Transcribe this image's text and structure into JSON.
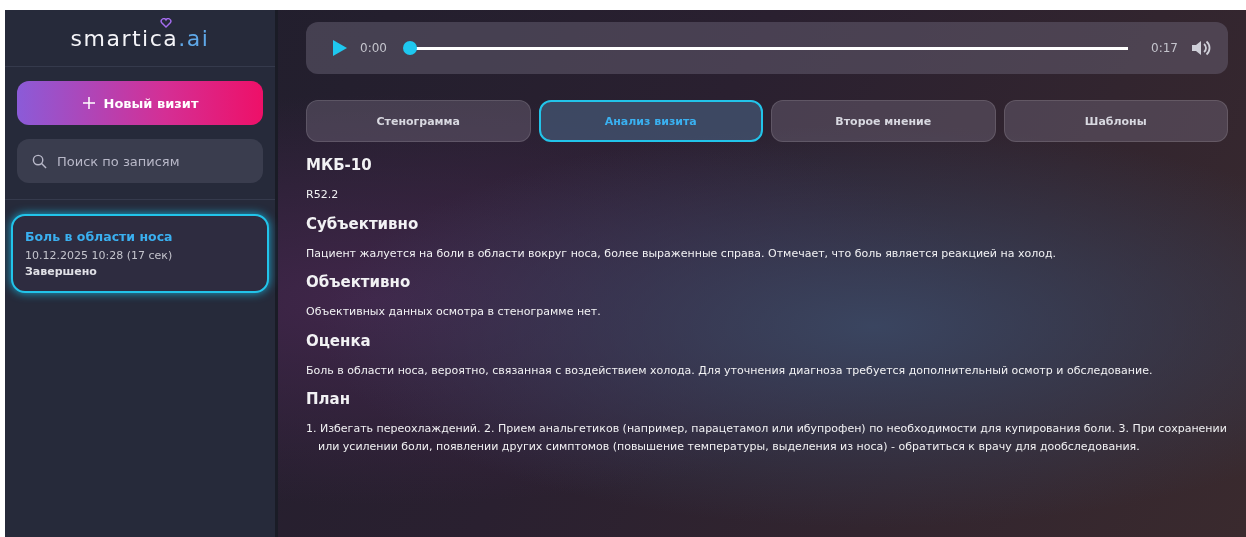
{
  "sidebar": {
    "logo": {
      "name": "smartica",
      "suffix": ".ai"
    },
    "new_button": {
      "label": "Новый визит"
    },
    "search": {
      "placeholder": "Поиск по записям"
    },
    "visits": [
      {
        "title": "Боль в области носа",
        "date": "10.12.2025 10:28 (17 сек)",
        "status": "Завершено",
        "selected": true
      }
    ]
  },
  "player": {
    "current": "0:00",
    "duration": "0:17",
    "level": 0
  },
  "tabs": [
    {
      "label": "Стенограмма",
      "selected": false
    },
    {
      "label": "Анализ визита",
      "selected": true
    },
    {
      "label": "Второе мнение",
      "selected": false
    },
    {
      "label": "Шаблоны",
      "selected": false
    }
  ],
  "sections": [
    {
      "heading": "МКБ-10",
      "text": "R52.2"
    },
    {
      "heading": "Субъективно",
      "text": "Пациент жалуется на боли в области вокруг носа, более выраженные справа. Отмечает, что боль является реакцией на холод."
    },
    {
      "heading": "Объективно",
      "text": "Объективных данных осмотра в стенограмме нет."
    },
    {
      "heading": "Оценка",
      "text": "Боль в области носа, вероятно, связанная с воздействием холода. Для уточнения диагноза требуется дополнительный осмотр и обследование."
    },
    {
      "heading": "План",
      "text": "1. Избегать переохлаждений. 2. Прием анальгетиков (например, парацетамол или ибупрофен) по необходимости для купирования боли. 3. При сохранении или усилении боли, появлении других симптомов (повышение температуры, выделения из носа) - обратиться к врачу для дообследования."
    }
  ]
}
